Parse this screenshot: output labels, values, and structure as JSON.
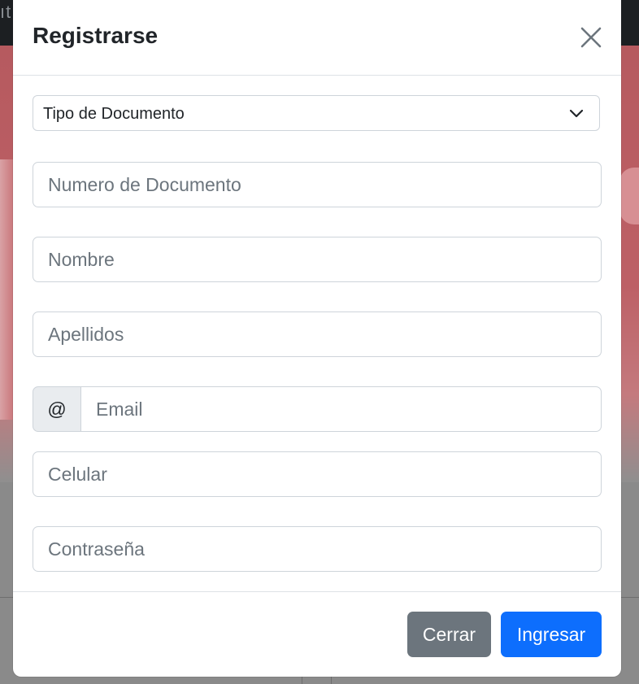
{
  "background": {
    "topbar_text": "ıt"
  },
  "modal": {
    "title": "Registrarse",
    "close_icon": "close-icon",
    "document_type": {
      "selected": "Tipo de Documento",
      "icon": "chevron-down-icon"
    },
    "fields": {
      "document_number_placeholder": "Numero de Documento",
      "name_placeholder": "Nombre",
      "surname_placeholder": "Apellidos",
      "email_addon": "@",
      "email_placeholder": "Email",
      "phone_placeholder": "Celular",
      "password_placeholder": "Contraseña"
    },
    "footer": {
      "close_label": "Cerrar",
      "submit_label": "Ingresar"
    }
  },
  "colors": {
    "primary": "#0d6efd",
    "secondary": "#6c757d",
    "hero": "#bd6066"
  }
}
